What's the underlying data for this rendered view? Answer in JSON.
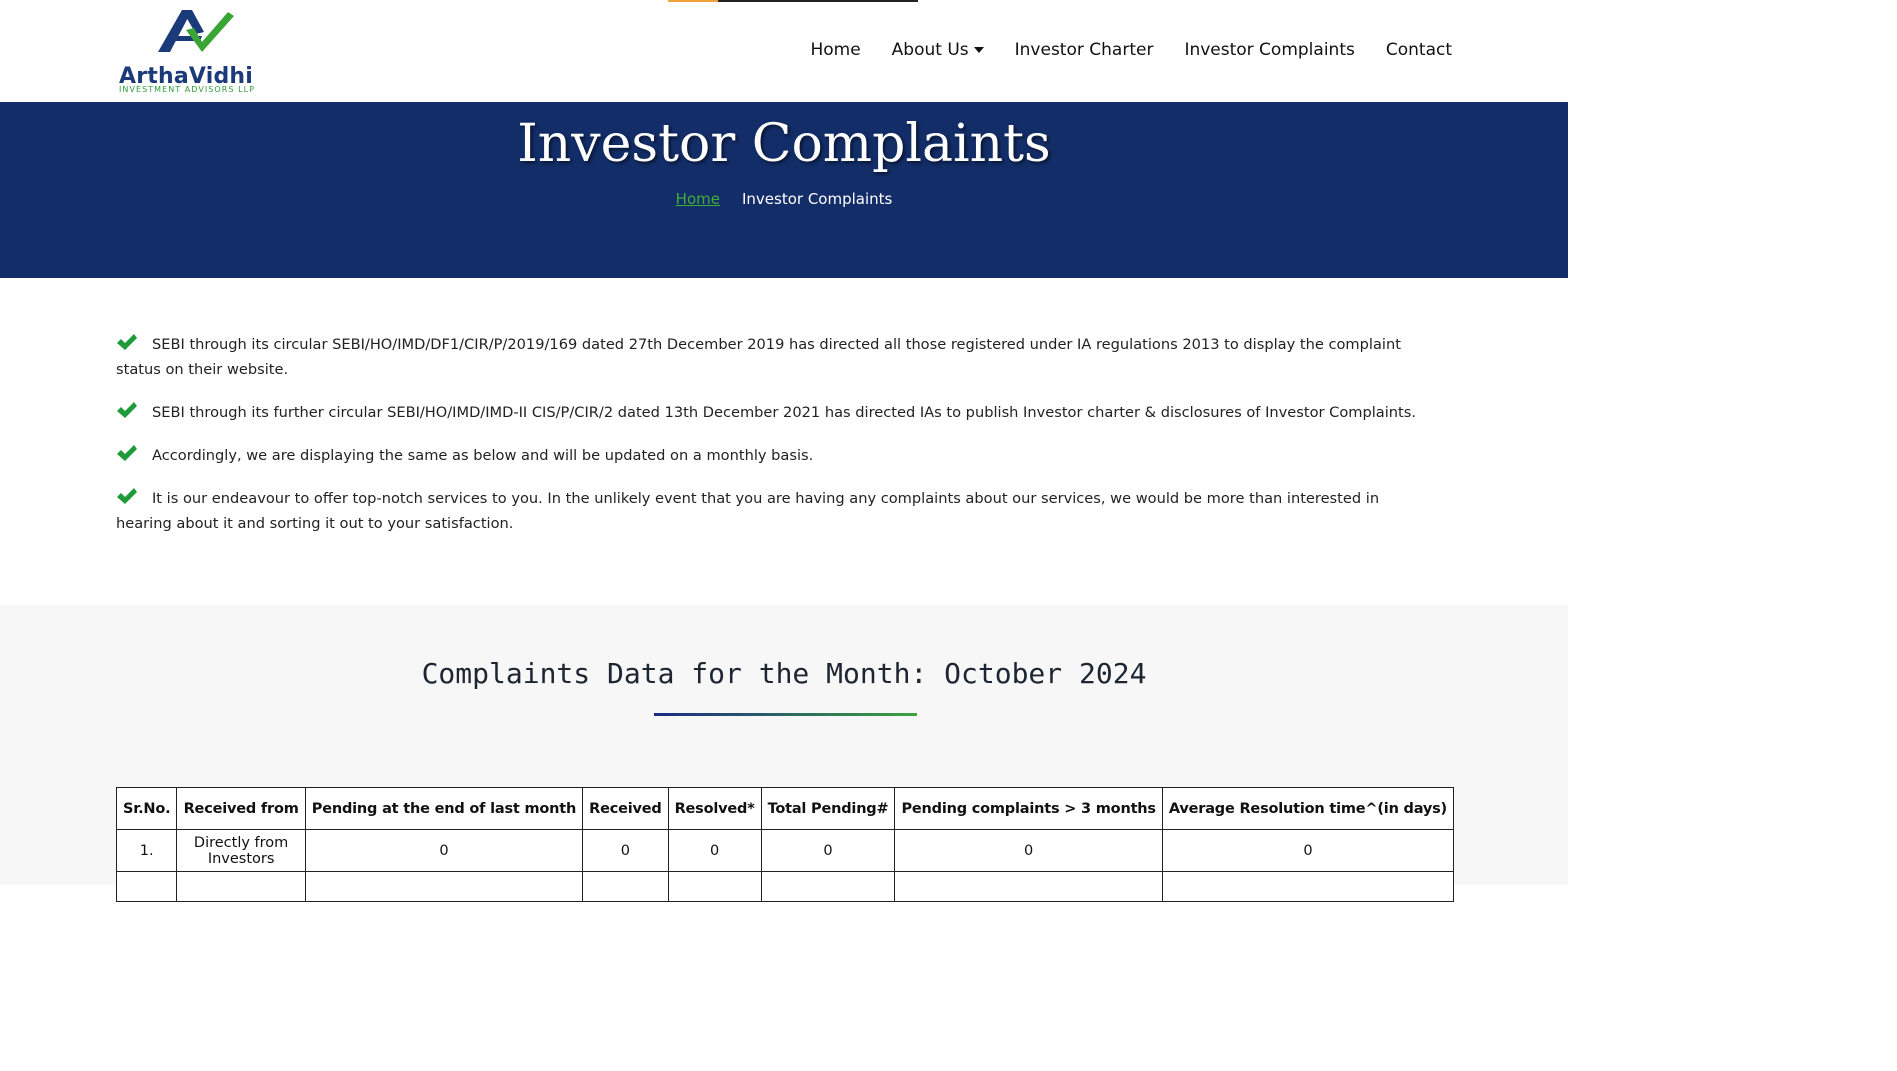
{
  "brand": {
    "name": "ArthaVidhi",
    "tagline": "INVESTMENT ADVISORS LLP",
    "colors": {
      "navy": "#1b3a7a",
      "green": "#2f9a3a"
    }
  },
  "nav": {
    "items": [
      {
        "label": "Home"
      },
      {
        "label": "About Us"
      },
      {
        "label": "Investor Charter"
      },
      {
        "label": "Investor Complaints"
      },
      {
        "label": "Contact"
      }
    ]
  },
  "banner": {
    "title": "Investor Complaints",
    "background": "#132d68",
    "breadcrumb": {
      "home": "Home",
      "current": "Investor Complaints"
    }
  },
  "bullets": [
    "SEBI through its circular SEBI/HO/IMD/DF1/CIR/P/2019/169 dated 27th December 2019 has directed all those registered under IA regulations 2013 to display the complaint status on their website.",
    "SEBI through its further circular SEBI/HO/IMD/IMD-II CIS/P/CIR/2 dated 13th December 2021 has directed IAs to publish Investor charter & disclosures of Investor Complaints.",
    "Accordingly, we are displaying the same as below and will be updated on a monthly basis.",
    "It is our endeavour to offer top-notch services to you. In the unlikely event that you are having any complaints about our services, we would be more than interested in hearing about it and sorting it out to your satisfaction."
  ],
  "complaints": {
    "heading": "Complaints Data for the Month: October 2024",
    "columns": [
      "Sr.No.",
      "Received from",
      "Pending at the end of last month",
      "Received",
      "Resolved*",
      "Total Pending#",
      "Pending complaints > 3 months",
      "Average Resolution time^(in days)"
    ],
    "rows": [
      [
        "1.",
        "Directly from Investors",
        "0",
        "0",
        "0",
        "0",
        "0",
        "0"
      ]
    ]
  }
}
